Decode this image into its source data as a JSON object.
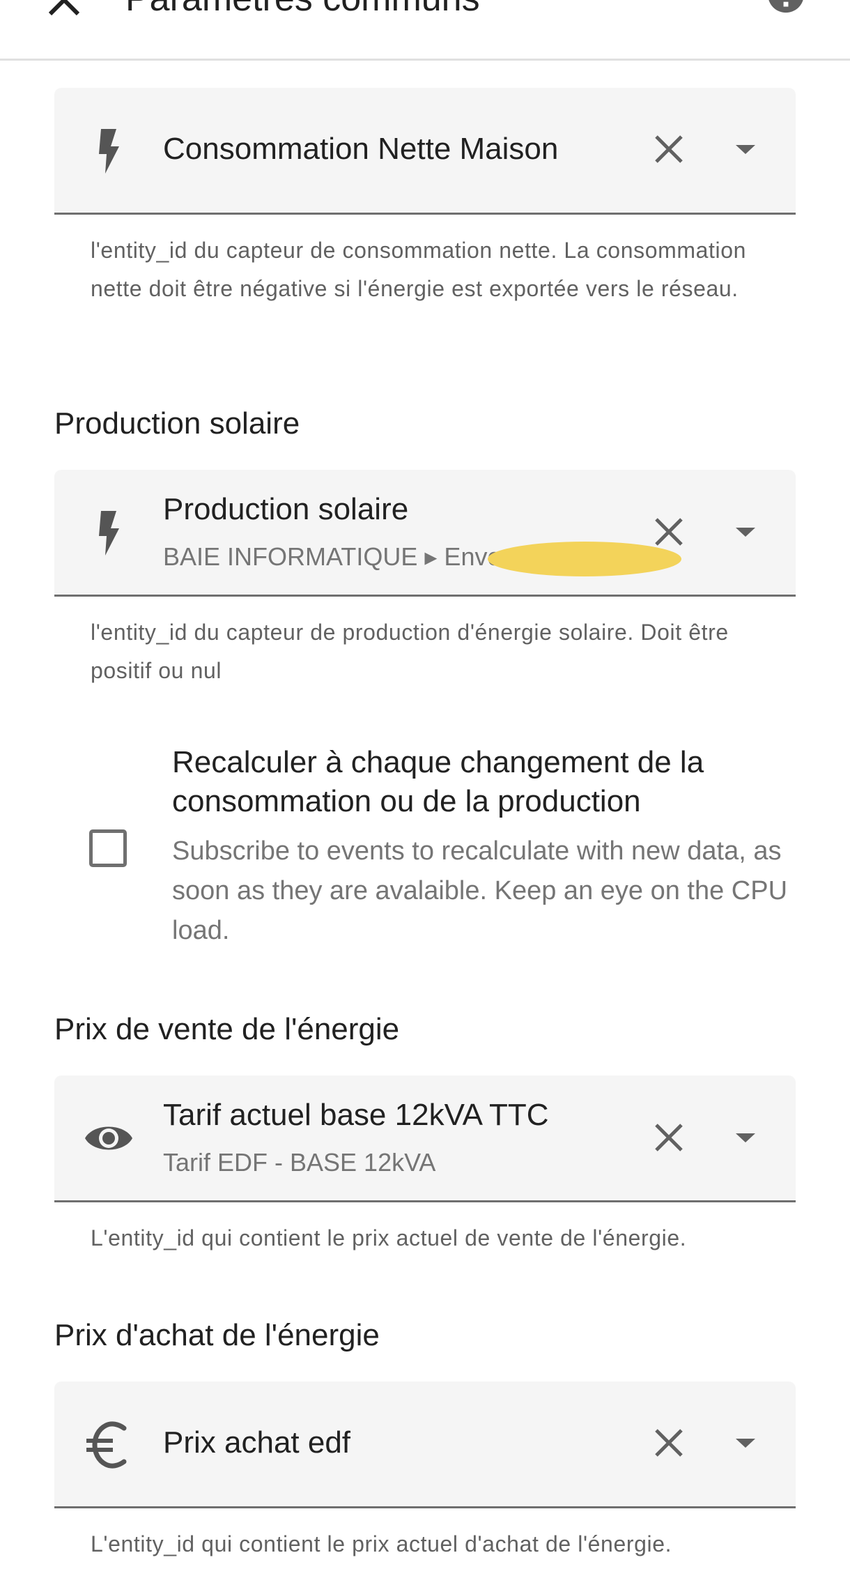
{
  "header": {
    "title": "Paramètres communs"
  },
  "net_consumption": {
    "value": "Consommation Nette Maison",
    "helper": "l'entity_id du capteur de consommation nette. La consommation nette doit être négative si l'énergie est exportée vers le réseau."
  },
  "solar": {
    "section_title": "Production solaire",
    "value": "Production solaire",
    "secondary": "BAIE INFORMATIQUE ▸ Envo",
    "helper": "l'entity_id du capteur de production d'énergie solaire. Doit être positif ou nul"
  },
  "recalculate": {
    "label": "Recalculer à chaque changement de la consommation ou de la production",
    "description": "Subscribe to events to recalculate with new data, as soon as they are avalaible. Keep an eye on the CPU load.",
    "checked": false
  },
  "sell_price": {
    "section_title": "Prix de vente de l'énergie",
    "value": "Tarif actuel base 12kVA TTC",
    "secondary": "Tarif EDF - BASE 12kVA",
    "helper": "L'entity_id qui contient le prix actuel de vente de l'énergie."
  },
  "buy_price": {
    "section_title": "Prix d'achat de l'énergie",
    "value": "Prix achat edf",
    "helper": "L'entity_id qui contient le prix actuel d'achat de l'énergie."
  },
  "icons": {
    "close": "close-icon",
    "help": "help-circle-icon",
    "lightning": "lightning-bolt-icon",
    "eye": "eye-icon",
    "euro": "euro-icon",
    "clear": "clear-x-icon",
    "dropdown": "menu-down-icon"
  },
  "colors": {
    "field_bg": "#f5f5f5",
    "icon": "#555555",
    "redaction": "#f3d35a"
  }
}
